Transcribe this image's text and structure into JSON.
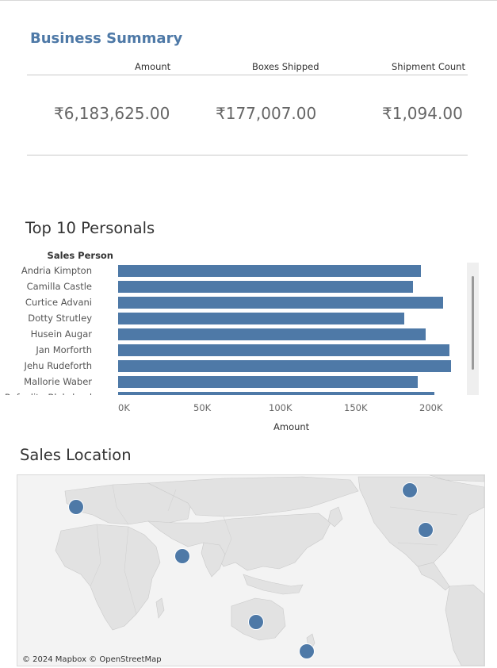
{
  "business_summary": {
    "title": "Business Summary",
    "columns": [
      {
        "header": "Amount",
        "value": "₹6,183,625.00"
      },
      {
        "header": "Boxes Shipped",
        "value": "₹177,007.00"
      },
      {
        "header": "Shipment Count",
        "value": "₹1,094.00"
      }
    ]
  },
  "top10": {
    "title": "Top 10 Personals",
    "row_header": "Sales Person",
    "x_axis_label": "Amount",
    "ticks": [
      "0K",
      "50K",
      "100K",
      "150K",
      "200K"
    ],
    "scrollbar": true
  },
  "chart_data": {
    "type": "bar",
    "orientation": "horizontal",
    "title": "Top 10 Personals",
    "categories": [
      "Andria Kimpton",
      "Camilla Castle",
      "Curtice Advani",
      "Dotty Strutley",
      "Husein Augar",
      "Jan Morforth",
      "Jehu Rudeforth",
      "Mallorie Waber",
      "Rafaelita Blaksland"
    ],
    "values": [
      201000,
      196000,
      216000,
      190000,
      204000,
      220000,
      221000,
      199000,
      210000
    ],
    "xlabel": "Amount",
    "ylabel": "Sales Person",
    "xlim": [
      0,
      240000
    ],
    "color": "#4e79a7"
  },
  "sales_location": {
    "title": "Sales Location",
    "attribution": "© 2024 Mapbox © OpenStreetMap",
    "dot_color": "#4e79a7"
  },
  "colors": {
    "accent": "#4e79a7",
    "map_land": "#e6e6e6",
    "map_water": "#f2f2f2"
  }
}
